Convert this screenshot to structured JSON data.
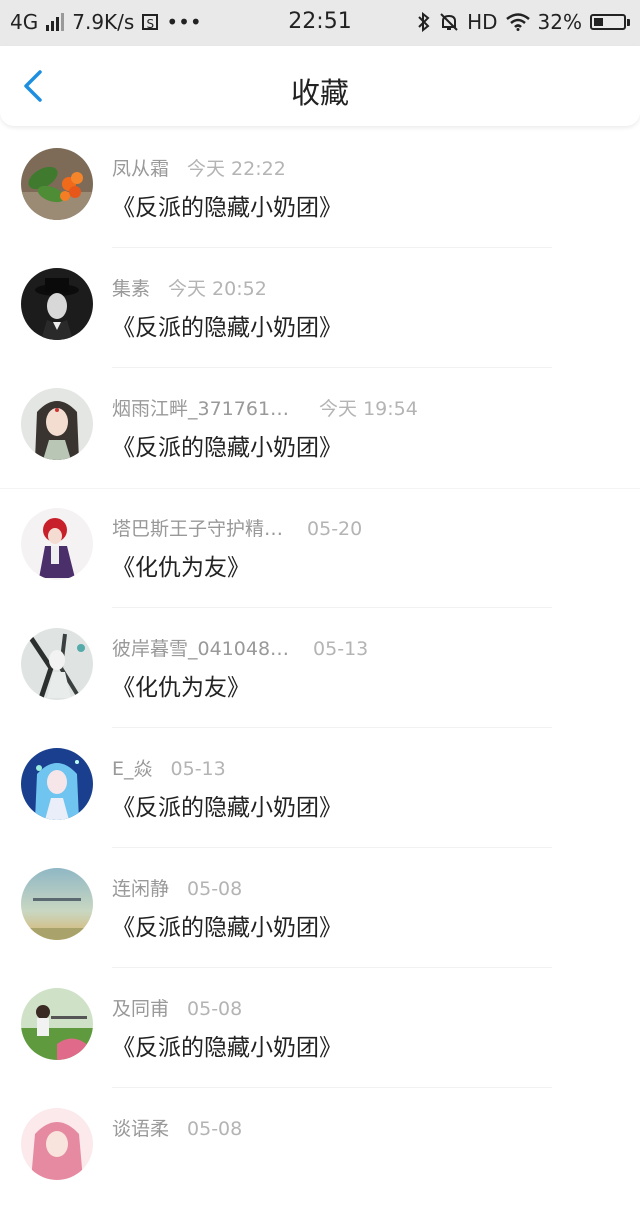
{
  "status_bar": {
    "network": "4G",
    "speed": "7.9K/s",
    "s_badge": "S",
    "dots": "•••",
    "time": "22:51",
    "hd": "HD",
    "battery": "32%",
    "battery_level": 0.32
  },
  "header": {
    "title": "收藏"
  },
  "items": [
    {
      "name": "凤从霜",
      "time": "今天 22:22",
      "book": "《反派的隐藏小奶团》",
      "avatar": "flower-photo"
    },
    {
      "name": "集素",
      "time": "今天 20:52",
      "book": "《反派的隐藏小奶团》",
      "avatar": "man-in-hat-portrait"
    },
    {
      "name": "烟雨江畔_371761…",
      "time": "今天 19:54",
      "book": "《反派的隐藏小奶团》",
      "avatar": "ancient-lady-illustration"
    },
    {
      "name": "塔巴斯王子守护精…",
      "time": "05-20",
      "book": "《化仇为友》",
      "avatar": "red-hair-anime-girl"
    },
    {
      "name": "彼岸暮雪_041048…",
      "time": "05-13",
      "book": "《化仇为友》",
      "avatar": "ink-anime-figure"
    },
    {
      "name": "E_焱",
      "time": "05-13",
      "book": "《反派的隐藏小奶团》",
      "avatar": "blue-hair-anime-girl"
    },
    {
      "name": "连闲静",
      "time": "05-08",
      "book": "《反派的隐藏小奶团》",
      "avatar": "sky-landscape"
    },
    {
      "name": "及同甫",
      "time": "05-08",
      "book": "《反派的隐藏小奶团》",
      "avatar": "girl-in-field"
    },
    {
      "name": "谈语柔",
      "time": "05-08",
      "book": "",
      "avatar": "pink-hair-anime-girl"
    }
  ]
}
